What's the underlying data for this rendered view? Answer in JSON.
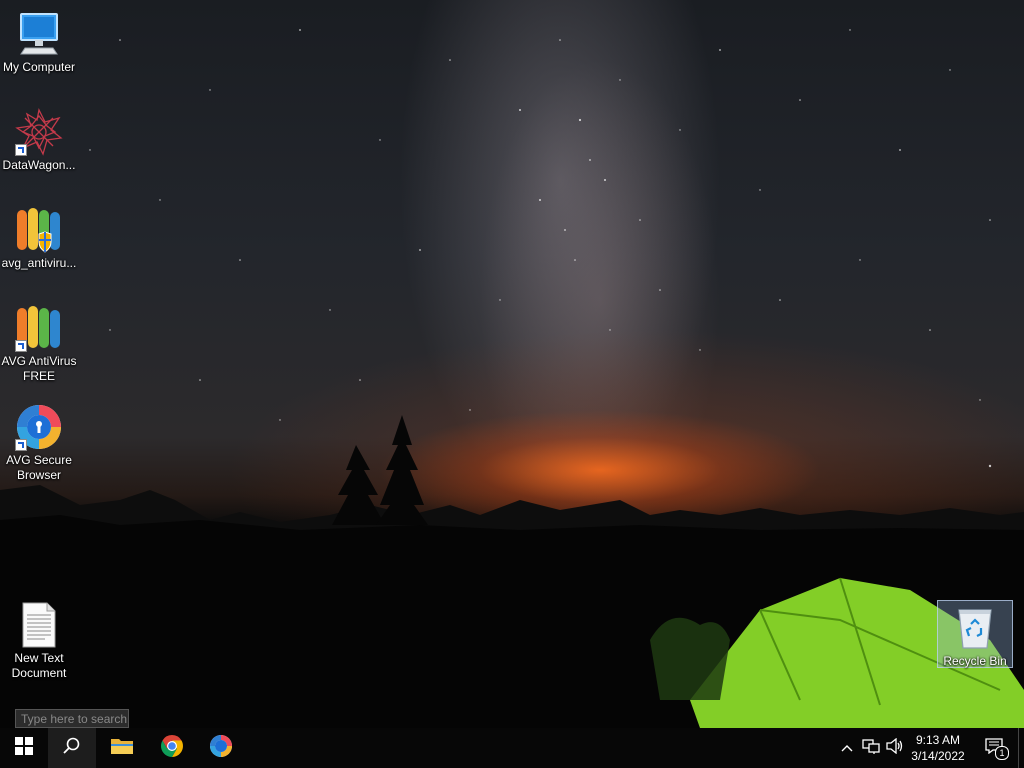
{
  "desktop": {
    "icons": [
      {
        "label": "My Computer",
        "icon": "monitor-icon"
      },
      {
        "label": "DataWagon...",
        "icon": "datawagon-icon"
      },
      {
        "label": "avg_antiviru...",
        "icon": "avg-installer-icon"
      },
      {
        "label": "AVG AntiVirus FREE",
        "icon": "avg-antivirus-icon"
      },
      {
        "label": "AVG Secure Browser",
        "icon": "avg-browser-icon"
      },
      {
        "label": "New Text Document",
        "icon": "text-file-icon"
      },
      {
        "label": "Recycle Bin",
        "icon": "recycle-bin-icon"
      }
    ]
  },
  "search": {
    "placeholder": "Type here to search"
  },
  "taskbar": {
    "pinned": [
      "start-icon",
      "search-icon",
      "file-explorer-icon",
      "chrome-icon",
      "avg-browser-icon"
    ],
    "clock": {
      "time": "9:13 AM",
      "date": "3/14/2022"
    },
    "notifications_count": "1"
  },
  "colors": {
    "taskbar": "#070707",
    "accent": "#1c5fd1",
    "tent": "#8ee02a"
  }
}
